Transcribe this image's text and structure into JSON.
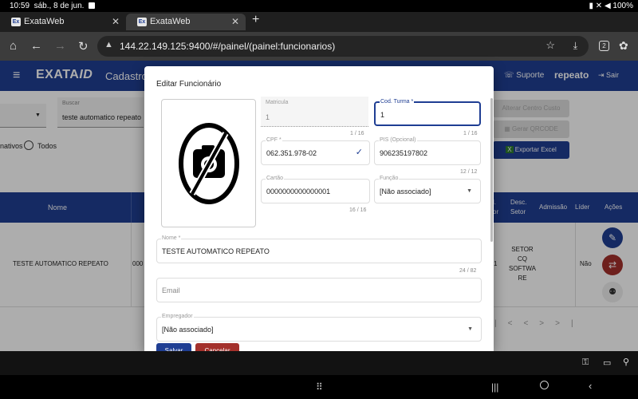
{
  "status": {
    "time": "10:59",
    "date": "sáb., 8 de jun.",
    "battery": "100%"
  },
  "browser": {
    "tabs": [
      {
        "label": "ExataWeb"
      },
      {
        "label": "ExataWeb"
      }
    ],
    "favicon": "Ex",
    "url": "144.22.149.125:9400/#/painel/(painel:funcionarios)",
    "tab_count": "2"
  },
  "app": {
    "logo": "EXATA",
    "logo_suffix": "ID",
    "page_title": "Cadastro",
    "support": "Suporte",
    "user": "repeato",
    "logout": "Sair"
  },
  "background": {
    "search_label": "Buscar",
    "search_value": "teste automatico repeato",
    "radio_inactive": "nativos",
    "radio_all": "Todos",
    "btn_change_cost": "Alterar Centro Custo",
    "btn_qrcode": "Gerar QRCODE",
    "btn_excel": "Exportar Excel",
    "cols": {
      "nome": "Nome",
      "setor1": "l.",
      "setor2": "or",
      "desc1": "Desc.",
      "desc2": "Setor",
      "admissao": "Admissão",
      "lider": "Líder",
      "acoes": "Ações"
    },
    "row": {
      "nome": "TESTE AUTOMATICO REPEATO",
      "code": "000",
      "digit": "1",
      "setor": [
        "SETOR",
        "CQ",
        "SOFTWA",
        "RE"
      ],
      "lider": "Não"
    },
    "pager": {
      "first": "|<",
      "prev": "<",
      "next": ">",
      "last": ">|"
    }
  },
  "dialog": {
    "title": "Editar Funcionário",
    "matricula": {
      "label": "Matricula",
      "value": "1",
      "hint": "1 / 16"
    },
    "cod_turma": {
      "label": "Cod. Turma *",
      "value": "1",
      "hint": "1 / 16"
    },
    "cpf": {
      "label": "CPF *",
      "value": "062.351.978-02"
    },
    "pis": {
      "label": "PIS (Opcional)",
      "value": "906235197802",
      "hint": "12 / 12"
    },
    "cartao": {
      "label": "Cartão",
      "value": "0000000000000001",
      "hint": "16 / 16"
    },
    "funcao": {
      "label": "Função",
      "value": "[Não associado]"
    },
    "nome": {
      "label": "Nome *",
      "value": "TESTE AUTOMATICO REPEATO",
      "hint": "24 / 82"
    },
    "email": {
      "placeholder": "Email"
    },
    "empregador": {
      "label": "Empregador",
      "value": "[Não associado]"
    },
    "save": "Salvar",
    "cancel": "Cancelar"
  },
  "colors": {
    "primary": "#1f3e93",
    "danger": "#a3302b",
    "green": "#2e7d32"
  }
}
